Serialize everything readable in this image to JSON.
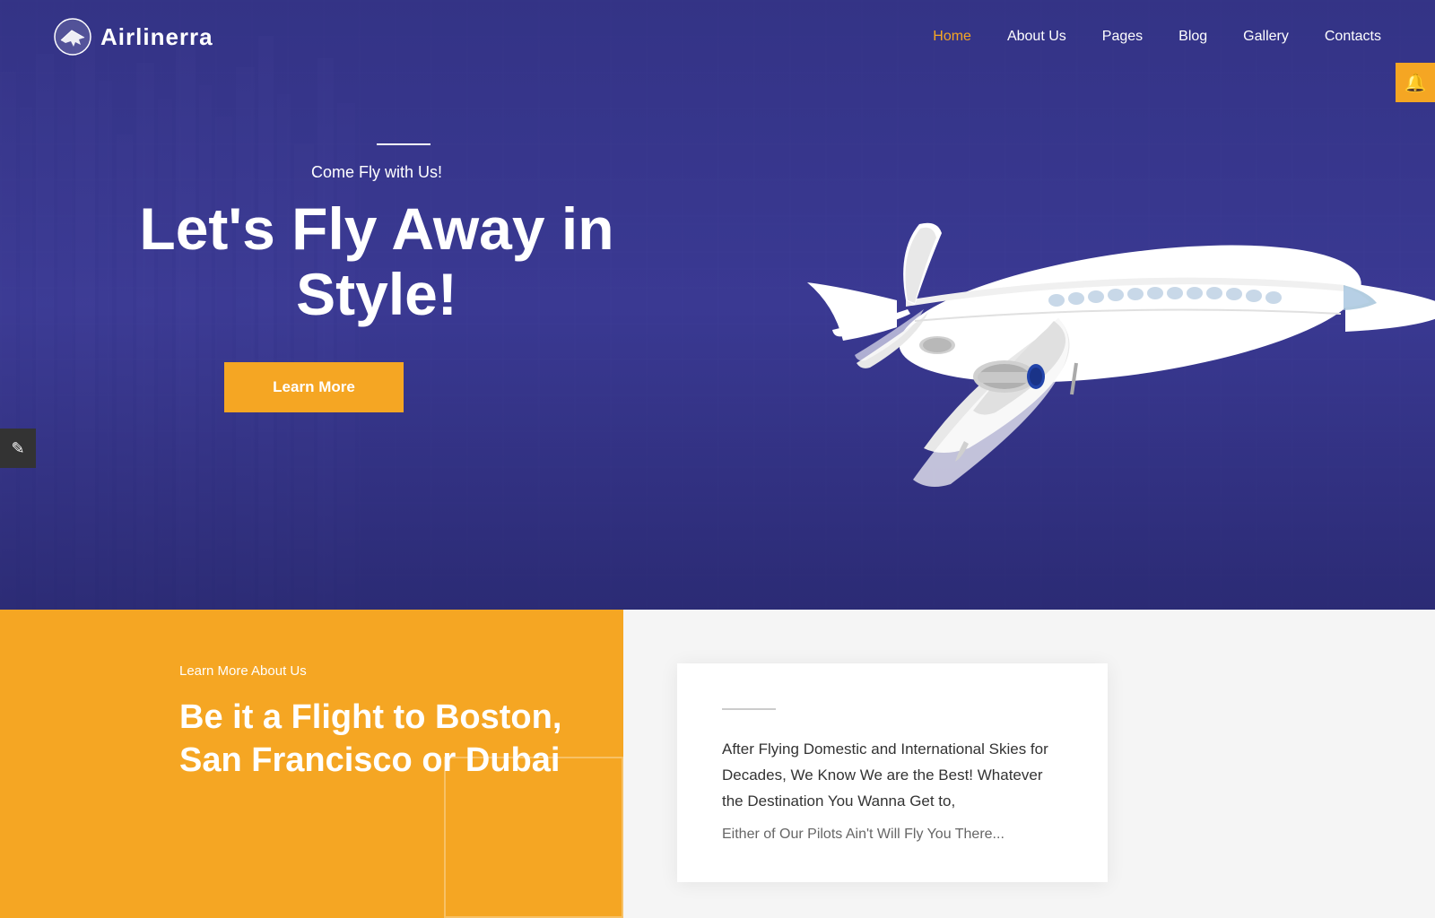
{
  "logo": {
    "text": "Airlinerra"
  },
  "nav": {
    "items": [
      {
        "label": "Home",
        "active": true
      },
      {
        "label": "About Us",
        "active": false
      },
      {
        "label": "Pages",
        "active": false
      },
      {
        "label": "Blog",
        "active": false
      },
      {
        "label": "Gallery",
        "active": false
      },
      {
        "label": "Contacts",
        "active": false
      }
    ]
  },
  "hero": {
    "subtitle": "Come Fly with Us!",
    "title": "Let's Fly Away in\nStyle!",
    "cta_label": "Learn More"
  },
  "bottom": {
    "left": {
      "label": "Learn More About Us",
      "title": "Be it a Flight to Boston, San Francisco or Dubai"
    },
    "right": {
      "card_text": "After Flying Domestic and International Skies for Decades, We Know We are the Best! Whatever the Destination You Wanna Get to,",
      "card_text2": "Either of Our Pilots Ain't Will Fly You There..."
    }
  },
  "edit_icon": "✎",
  "notification_icon": "🔔",
  "colors": {
    "primary": "#F5A623",
    "hero_bg": "#3B3D8E",
    "nav_active": "#F5A623"
  }
}
